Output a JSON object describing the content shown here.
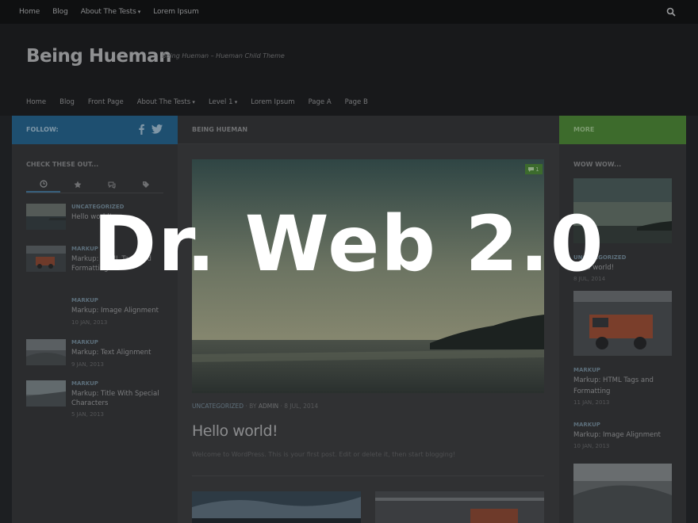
{
  "topbar": {
    "items": [
      "Home",
      "Blog",
      "About The Tests",
      "Lorem Ipsum"
    ]
  },
  "header": {
    "title": "Being Hueman",
    "description": "Being Hueman – Hueman Child Theme",
    "nav": [
      "Home",
      "Blog",
      "Front Page",
      "About The Tests",
      "Level 1",
      "Lorem Ipsum",
      "Page A",
      "Page B"
    ]
  },
  "follow": {
    "label": "FOLLOW:"
  },
  "breadcrumb": "BEING HUEMAN",
  "more": {
    "label": "MORE"
  },
  "sidebar": {
    "heading": "CHECK THESE OUT...",
    "posts": [
      {
        "category": "UNCATEGORIZED",
        "title": "Hello world!",
        "date": ""
      },
      {
        "category": "MARKUP",
        "title": "Markup: HTML Tags and Formatting",
        "date": ""
      },
      {
        "category": "MARKUP",
        "title": "Markup: Image Alignment",
        "date": "10 JAN, 2013"
      },
      {
        "category": "MARKUP",
        "title": "Markup: Text Alignment",
        "date": "9 JAN, 2013"
      },
      {
        "category": "MARKUP",
        "title": "Markup: Title With Special Characters",
        "date": "5 JAN, 2013"
      }
    ]
  },
  "main": {
    "comment_count": "1",
    "meta": {
      "category": "UNCATEGORIZED",
      "by": "BY",
      "author": "ADMIN",
      "date": "8 JUL, 2014"
    },
    "title": "Hello world!",
    "excerpt": "Welcome to WordPress. This is your first post. Edit or delete it, then start blogging!"
  },
  "right": {
    "heading": "WOW WOW...",
    "posts": [
      {
        "category": "UNCATEGORIZED",
        "title": "Hello world!",
        "date": "8 JUL, 2014"
      },
      {
        "category": "MARKUP",
        "title": "Markup: HTML Tags and Formatting",
        "date": "11 JAN, 2013"
      },
      {
        "category": "MARKUP",
        "title": "Markup: Image Alignment",
        "date": "10 JAN, 2013"
      }
    ]
  },
  "overlay": {
    "text": "Dr. Web 2.0"
  },
  "colors": {
    "accent_blue": "#1e4f70",
    "accent_green": "#3d6b2c",
    "background": "#1d1f22"
  }
}
